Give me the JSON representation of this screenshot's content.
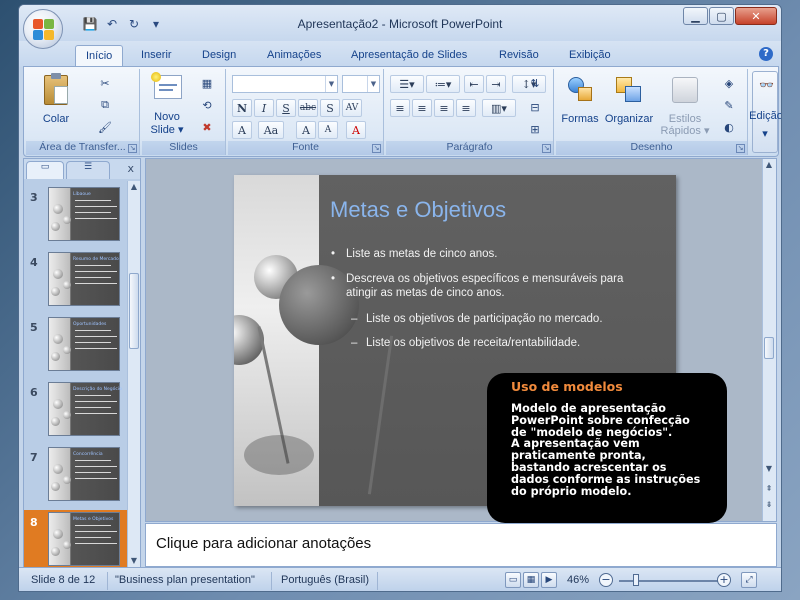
{
  "window": {
    "title": "Apresentação2 - Microsoft PowerPoint",
    "controls": {
      "minimize": "▁",
      "maximize": "▢",
      "close": "✕"
    }
  },
  "qat": {
    "save_icon": "💾",
    "undo_icon": "↶",
    "redo_icon": "↻",
    "customize_icon": "▾"
  },
  "tabs": [
    {
      "label": "Início",
      "active": true
    },
    {
      "label": "Inserir"
    },
    {
      "label": "Design"
    },
    {
      "label": "Animações"
    },
    {
      "label": "Apresentação de Slides"
    },
    {
      "label": "Revisão"
    },
    {
      "label": "Exibição"
    }
  ],
  "help_label": "?",
  "ribbon": {
    "clipboard": {
      "paste_label": "Colar",
      "group_label": "Área de Transfer..."
    },
    "slides": {
      "new_slide_label_1": "Novo",
      "new_slide_label_2": "Slide ▾",
      "group_label": "Slides"
    },
    "font": {
      "group_label": "Fonte",
      "buttons": [
        "N",
        "I",
        "S",
        "abc",
        "S",
        "AV",
        "A",
        "Aa",
        "A",
        "A",
        "A"
      ]
    },
    "paragraph": {
      "group_label": "Parágrafo"
    },
    "drawing": {
      "group_label": "Desenho",
      "shapes_label": "Formas",
      "arrange_label": "Organizar",
      "quick_styles_label_1": "Estilos",
      "quick_styles_label_2": "Rápidos ▾"
    },
    "editing": {
      "label": "Edição",
      "dropdown": "▾"
    }
  },
  "slides_pane": {
    "close_label": "x",
    "thumbnails": [
      {
        "number": "3",
        "title": "Líbaoue",
        "selected": false
      },
      {
        "number": "4",
        "title": "Resumo de Mercado",
        "selected": false
      },
      {
        "number": "5",
        "title": "Oportunidades",
        "selected": false
      },
      {
        "number": "6",
        "title": "Descrição do Negócio",
        "selected": false
      },
      {
        "number": "7",
        "title": "Concorrência",
        "selected": false
      },
      {
        "number": "8",
        "title": "Metas e Objetivos",
        "selected": true
      }
    ]
  },
  "slide": {
    "title": "Metas e Objetivos",
    "bullets": [
      {
        "text": "Liste as metas de cinco anos.",
        "mark": "•"
      },
      {
        "text": "Descreva os objetivos específicos e mensuráveis para",
        "text2": "atingir as metas de cinco anos.",
        "mark": "•"
      },
      {
        "text": "Liste os objetivos de participação no mercado.",
        "mark": "–"
      },
      {
        "text": "Liste os objetivos de receita/rentabilidade.",
        "mark": "–"
      }
    ]
  },
  "callout": {
    "title": "Uso de modelos",
    "lines": [
      "Modelo de apresentação",
      "PowerPoint sobre confecção",
      "de \"modelo de negócios\".",
      "A apresentação vem",
      "praticamente pronta,",
      "bastando acrescentar os",
      "dados conforme as instruções",
      "do próprio modelo."
    ]
  },
  "notes": {
    "placeholder": "Clique para adicionar anotações"
  },
  "status": {
    "slide_info": "Slide 8 de 12",
    "theme": "\"Business plan presentation\"",
    "language": "Português (Brasil)",
    "zoom": "46%",
    "zoom_fraction": 0.46
  },
  "colors": {
    "accent": "#e07b22",
    "title_blue": "#8ab5ec",
    "callout_title": "#f08a3c"
  }
}
